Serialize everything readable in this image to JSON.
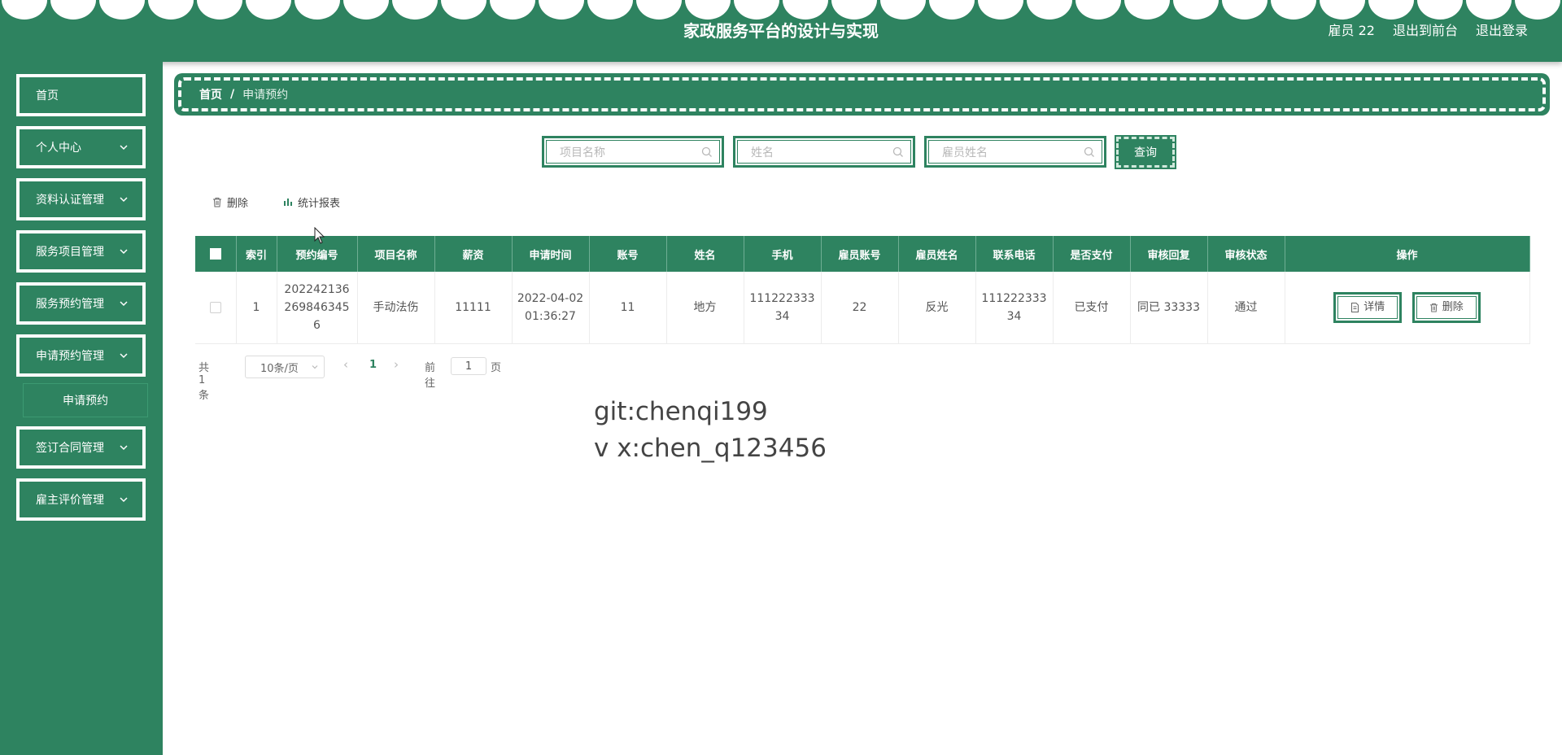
{
  "header": {
    "title": "家政服务平台的设计与实现",
    "user": "雇员 22",
    "to_front": "退出到前台",
    "logout": "退出登录"
  },
  "sidebar": {
    "items": [
      {
        "label": "首页"
      },
      {
        "label": "个人中心"
      },
      {
        "label": "资料认证管理"
      },
      {
        "label": "服务项目管理"
      },
      {
        "label": "服务预约管理"
      },
      {
        "label": "申请预约管理"
      },
      {
        "label": "签订合同管理"
      },
      {
        "label": "雇主评价管理"
      }
    ],
    "submenu": {
      "label": "申请预约"
    }
  },
  "breadcrumb": {
    "home": "首页",
    "separator": "/",
    "current": "申请预约"
  },
  "search": {
    "project_placeholder": "项目名称",
    "name_placeholder": "姓名",
    "employee_placeholder": "雇员姓名",
    "query_label": "查询"
  },
  "toolbar": {
    "delete_label": "删除",
    "report_label": "统计报表"
  },
  "table": {
    "headers": [
      "索引",
      "预约编号",
      "项目名称",
      "薪资",
      "申请时间",
      "账号",
      "姓名",
      "手机",
      "雇员账号",
      "雇员姓名",
      "联系电话",
      "是否支付",
      "审核回复",
      "审核状态",
      "操作"
    ],
    "rows": [
      {
        "index": "1",
        "booking_no": "2022421362698463456",
        "project": "手动法伤",
        "salary": "11111",
        "apply_time": "2022-04-02 01:36:27",
        "account": "11",
        "name": "地方",
        "phone": "11122233334",
        "employee_account": "22",
        "employee_name": "反光",
        "contact_phone": "11122233334",
        "paid": "已支付",
        "review_reply": "同已 33333",
        "review_status": "通过",
        "detail_label": "详情",
        "delete_label": "删除"
      }
    ]
  },
  "pagination": {
    "total": "共 1 条",
    "page_size": "10条/页",
    "current_page": "1",
    "goto_prefix": "前往",
    "goto_value": "1",
    "goto_suffix": "页"
  },
  "watermark": {
    "line1": "git:chenqi199",
    "line2": "v x:chen_q123456"
  },
  "colors": {
    "primary": "#2e8360",
    "white": "#ffffff"
  }
}
